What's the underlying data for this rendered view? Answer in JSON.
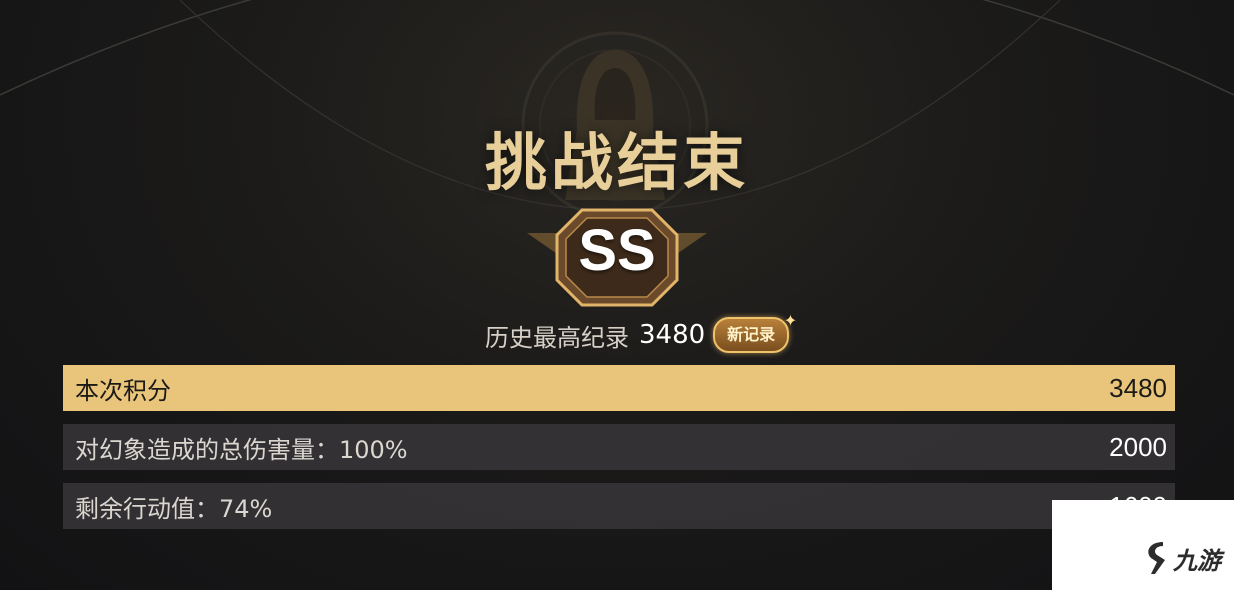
{
  "title": "挑战结束",
  "rank": "SS",
  "record": {
    "label": "历史最高纪录",
    "value": "3480",
    "badge": "新记录"
  },
  "rows": [
    {
      "label": "本次积分",
      "value": "3480"
    },
    {
      "label": "对幻象造成的总伤害量：100%",
      "value": "2000"
    },
    {
      "label": "剩余行动值：74%",
      "value": "1600"
    }
  ],
  "watermark": {
    "text": "九游"
  },
  "colors": {
    "gold": "#e8cf9a",
    "highlight": "#e9c47b",
    "background": "#1b1a19"
  }
}
